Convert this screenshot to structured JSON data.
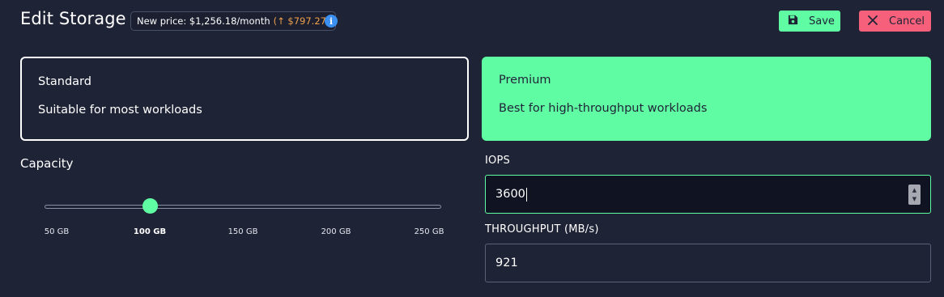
{
  "header": {
    "title": "Edit Storage",
    "price_text": "New price: $1,256.18/month",
    "price_change": "(↑ $797.27)",
    "info_icon": "i",
    "save_label": "Save",
    "cancel_label": "Cancel"
  },
  "tiers": [
    {
      "name": "Standard",
      "description": "Suitable for most workloads",
      "selected": false
    },
    {
      "name": "Premium",
      "description": "Best for high-throughput workloads",
      "selected": true
    }
  ],
  "capacity": {
    "label": "Capacity",
    "ticks": [
      "50 GB",
      "100 GB",
      "150 GB",
      "200 GB",
      "250 GB"
    ],
    "selected": "100 GB"
  },
  "iops": {
    "label": "IOPS",
    "value": "3600"
  },
  "throughput": {
    "label": "THROUGHPUT (MB/s)",
    "value": "921"
  },
  "colors": {
    "background": "#1f2336",
    "accent_green": "#60fca4",
    "cancel_red": "#f6607a",
    "price_increase": "#f0a24a",
    "info_blue": "#3b8ff0"
  },
  "icons": {
    "save": "floppy-disk-icon",
    "cancel": "x-icon",
    "info": "info-icon"
  }
}
